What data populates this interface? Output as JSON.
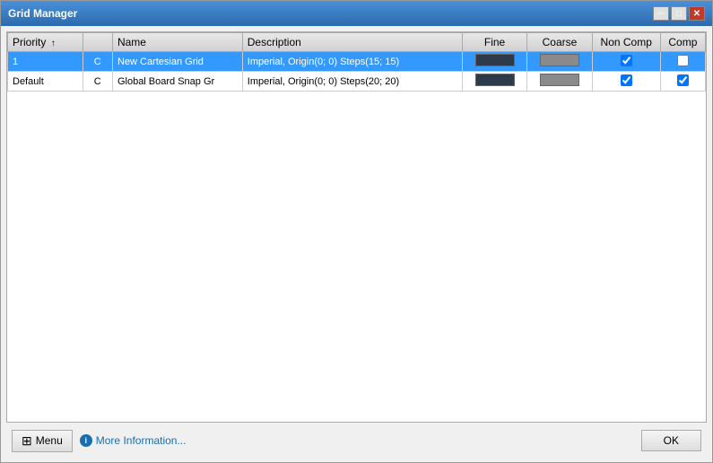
{
  "window": {
    "title": "Grid Manager"
  },
  "title_buttons": {
    "minimize": "─",
    "maximize": "□",
    "close": "✕"
  },
  "table": {
    "columns": [
      {
        "id": "priority",
        "label": "Priority",
        "sort": true
      },
      {
        "id": "type",
        "label": ""
      },
      {
        "id": "name",
        "label": "Name"
      },
      {
        "id": "description",
        "label": "Description"
      },
      {
        "id": "fine",
        "label": "Fine"
      },
      {
        "id": "coarse",
        "label": "Coarse"
      },
      {
        "id": "noncomp",
        "label": "Non Comp"
      },
      {
        "id": "comp",
        "label": "Comp"
      }
    ],
    "rows": [
      {
        "priority": "1",
        "type": "C",
        "name": "New Cartesian Grid",
        "description": "Imperial, Origin(0; 0) Steps(15; 15)",
        "fine_color": "dark",
        "coarse_color": "gray",
        "noncomp": true,
        "comp": false,
        "selected": true
      },
      {
        "priority": "Default",
        "type": "C",
        "name": "Global Board Snap Gr",
        "description": "Imperial, Origin(0; 0) Steps(20; 20)",
        "fine_color": "dark",
        "coarse_color": "gray",
        "noncomp": true,
        "comp": true,
        "selected": false
      }
    ]
  },
  "bottom": {
    "menu_label": "Menu",
    "info_label": "More Information...",
    "ok_label": "OK"
  }
}
